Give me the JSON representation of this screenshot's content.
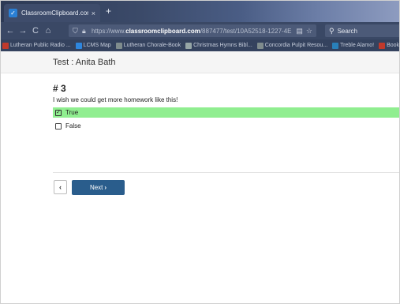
{
  "browser": {
    "tab_title": "ClassroomClipboard.com",
    "tab_close": "×",
    "new_tab": "+",
    "nav": {
      "back": "←",
      "forward": "→",
      "reload": "C",
      "home": "⌂"
    },
    "url_prefix": "https://www.",
    "url_domain": "classroomclipboard.com",
    "url_rest": "/887477/test/10A52518-1227-4E",
    "search_placeholder": "Search",
    "bookmarks": [
      {
        "label": "Lutheran Public Radio ...",
        "color": "#c0392b"
      },
      {
        "label": "LCMS Map",
        "color": "#2e86de"
      },
      {
        "label": "Lutheran Chorale-Book",
        "color": "#7f8c8d"
      },
      {
        "label": "Christmas Hymns Bibl...",
        "color": "#95a5a6"
      },
      {
        "label": "Concordia Pulpit Resou...",
        "color": "#7f8c8d"
      },
      {
        "label": "Treble Alamo!",
        "color": "#2980b9"
      },
      {
        "label": "Books – Tyre! B...",
        "color": "#c0392b"
      }
    ]
  },
  "page": {
    "title": "Test : Anita Bath",
    "question_number": "# 3",
    "question_text": "I wish we could get more homework like this!",
    "options": [
      {
        "label": "True",
        "selected": true,
        "mark": "✓"
      },
      {
        "label": "False",
        "selected": false,
        "mark": ""
      }
    ],
    "prev_label": "‹",
    "next_label": "Next",
    "next_chevron": "›"
  }
}
